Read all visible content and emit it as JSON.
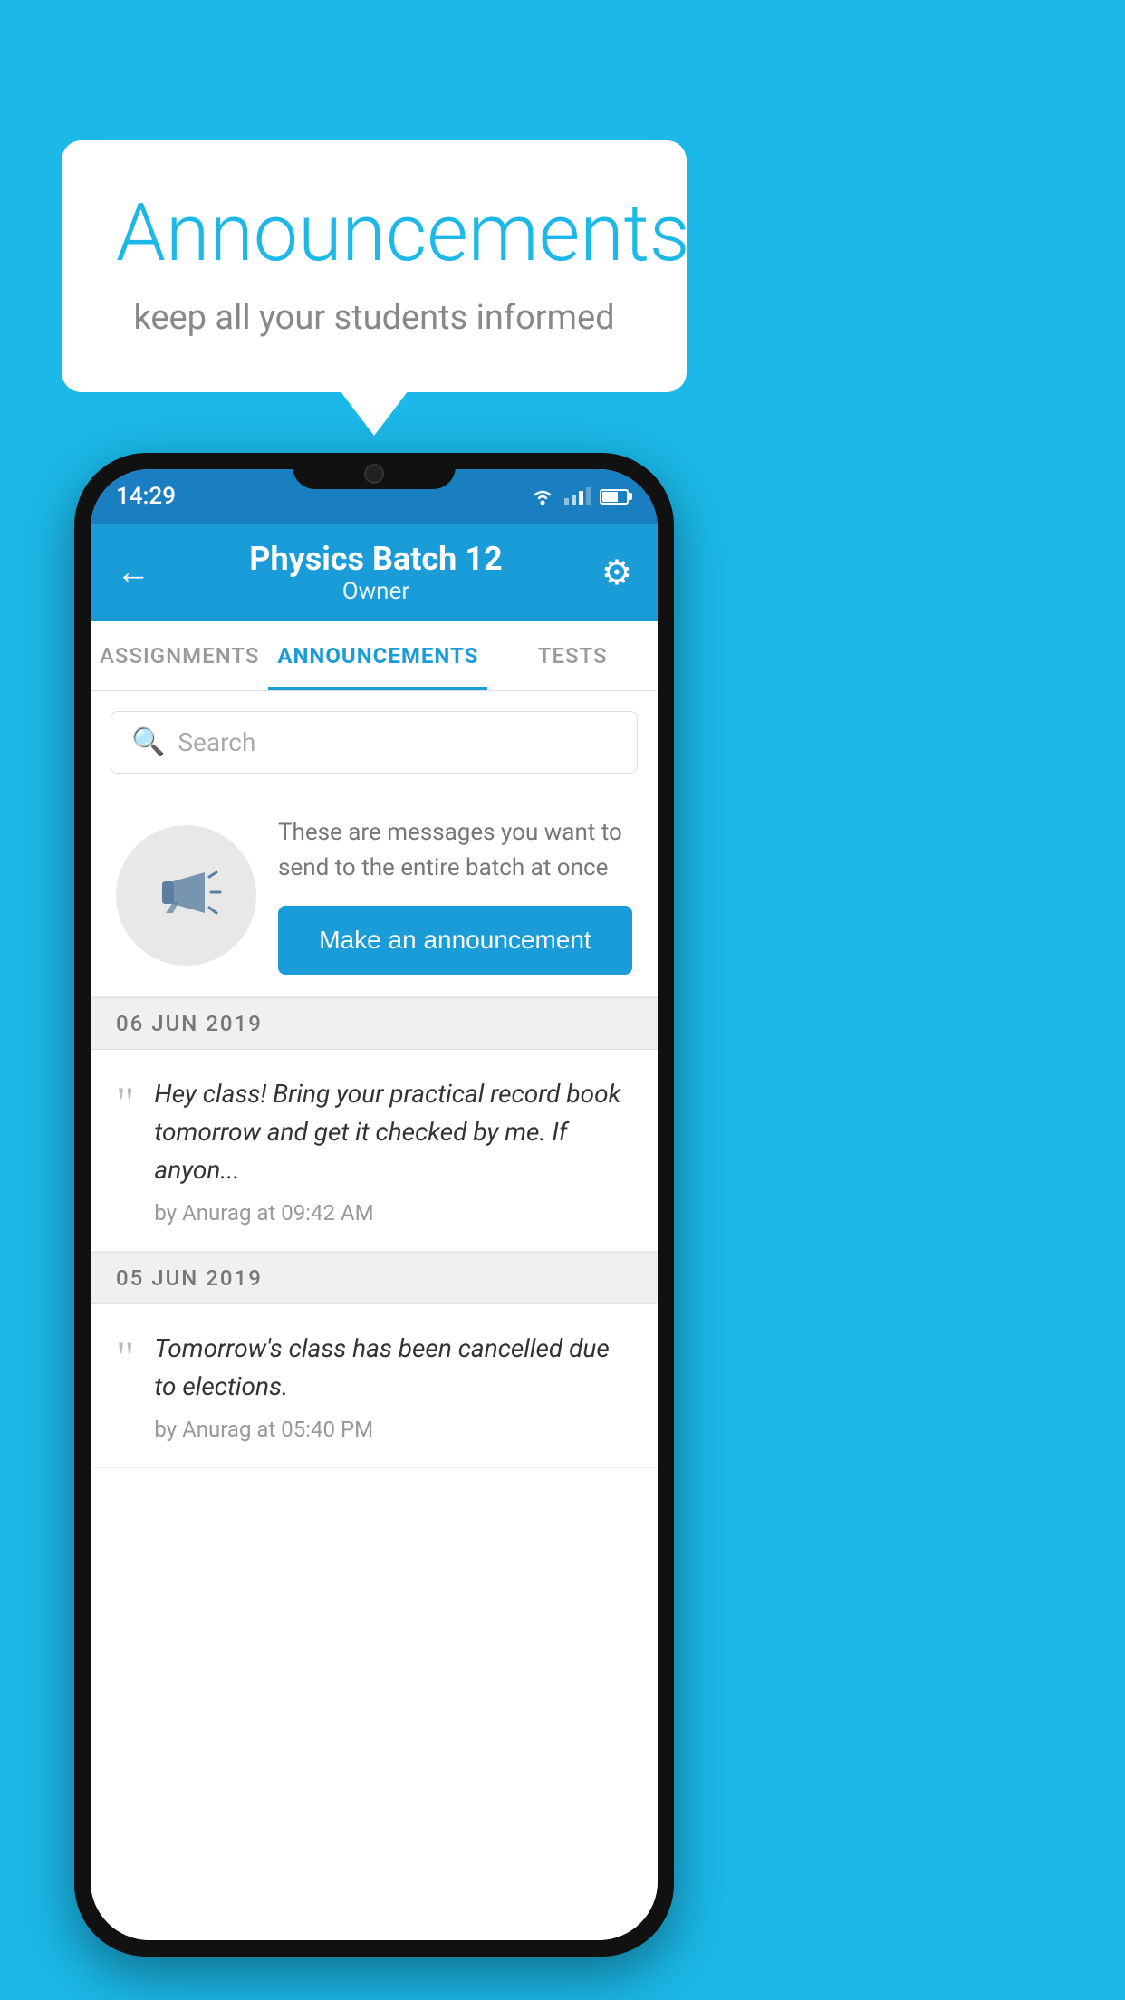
{
  "background_color": "#1bb8e8",
  "speech_bubble": {
    "title": "Announcements",
    "subtitle": "keep all your students informed"
  },
  "phone": {
    "status_bar": {
      "time": "14:29"
    },
    "header": {
      "title": "Physics Batch 12",
      "subtitle": "Owner",
      "back_label": "←",
      "settings_label": "⚙"
    },
    "tabs": [
      {
        "label": "ASSIGNMENTS",
        "active": false
      },
      {
        "label": "ANNOUNCEMENTS",
        "active": true
      },
      {
        "label": "TESTS",
        "active": false
      }
    ],
    "search": {
      "placeholder": "Search"
    },
    "promo": {
      "description": "These are messages you want to send to the entire batch at once",
      "button_label": "Make an announcement"
    },
    "announcements": [
      {
        "date": "06  JUN  2019",
        "message": "Hey class! Bring your practical record book tomorrow and get it checked by me. If anyon...",
        "meta": "by Anurag at 09:42 AM"
      },
      {
        "date": "05  JUN  2019",
        "message": "Tomorrow's class has been cancelled due to elections.",
        "meta": "by Anurag at 05:40 PM"
      }
    ]
  }
}
